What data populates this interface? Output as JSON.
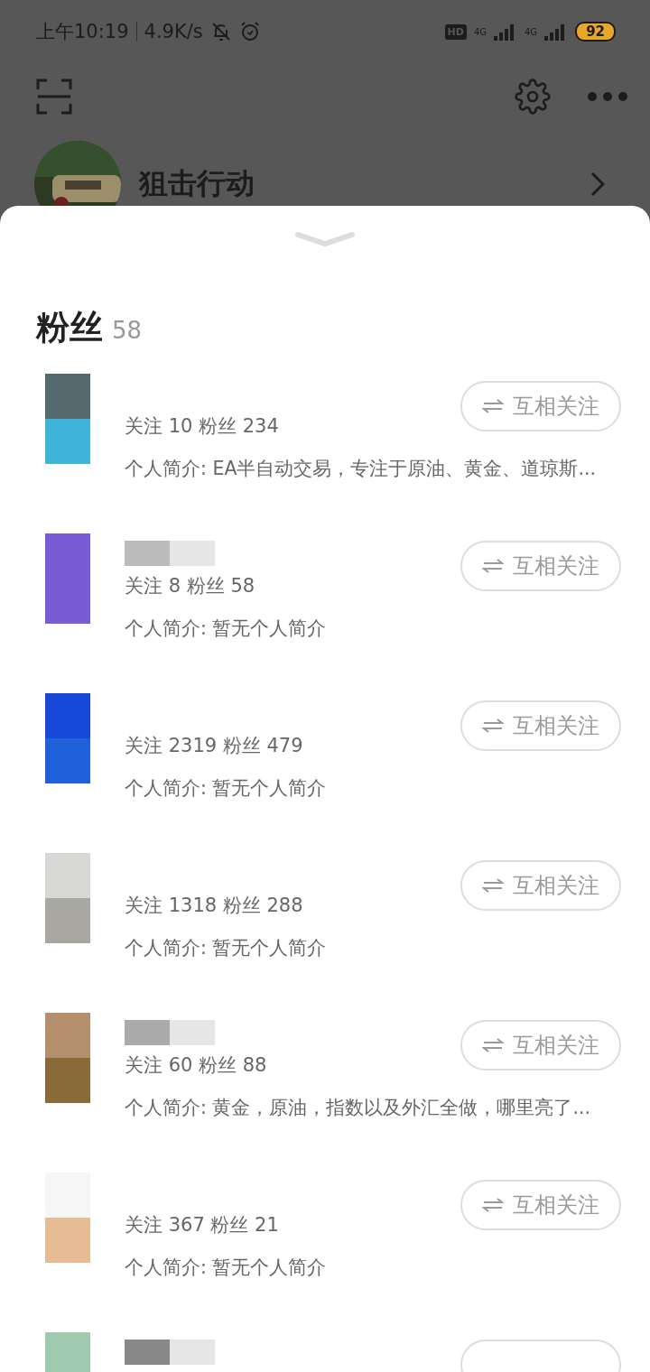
{
  "status_bar": {
    "time": "上午10:19",
    "speed": "4.9K/s",
    "hd": "HD",
    "network_1": "4G",
    "network_2": "4G",
    "battery": "92"
  },
  "profile": {
    "name": "狙击行动"
  },
  "sheet": {
    "title": "粉丝",
    "count": "58"
  },
  "followers": [
    {
      "stats": "关注 10 粉丝 234",
      "bio": "个人简介: EA半自动交易，专注于原油、黄金、道琼斯...",
      "button": "互相关注"
    },
    {
      "stats": "关注 8 粉丝 58",
      "bio": "个人简介: 暂无个人简介",
      "button": "互相关注"
    },
    {
      "stats": "关注 2319 粉丝 479",
      "bio": "个人简介: 暂无个人简介",
      "button": "互相关注"
    },
    {
      "stats": "关注 1318 粉丝 288",
      "bio": "个人简介: 暂无个人简介",
      "button": "互相关注"
    },
    {
      "stats": "关注 60 粉丝 88",
      "bio": "个人简介: 黄金，原油，指数以及外汇全做，哪里亮了...",
      "button": "互相关注"
    },
    {
      "stats": "关注 367 粉丝 21",
      "bio": "个人简介: 暂无个人简介",
      "button": "互相关注"
    }
  ],
  "more_below": true
}
